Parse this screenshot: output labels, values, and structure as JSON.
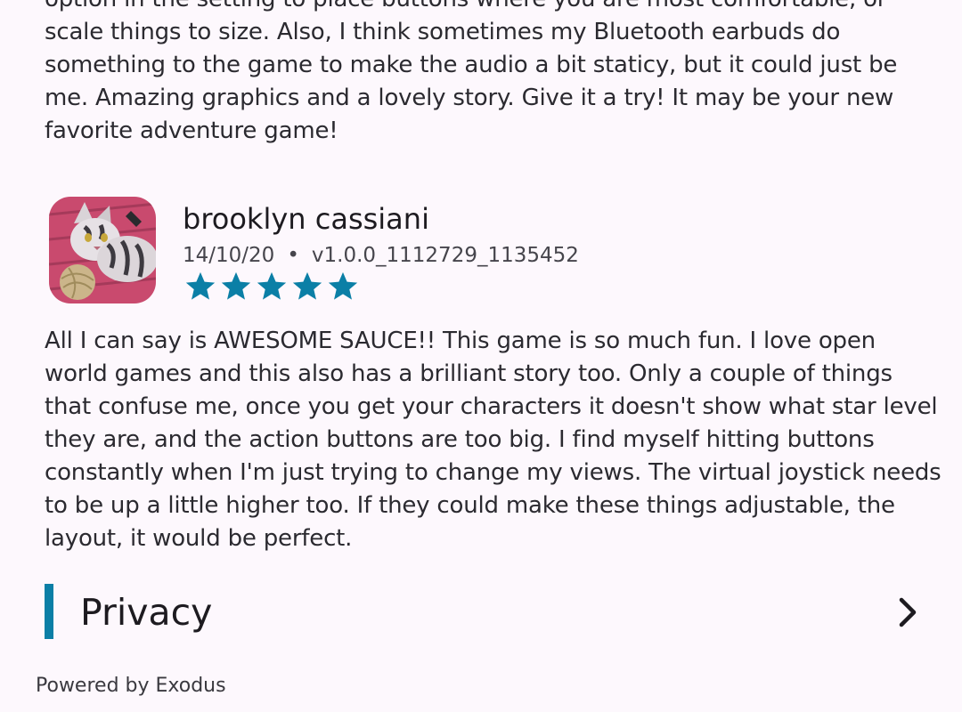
{
  "reviews": {
    "previous": {
      "text": "option in the setting to place buttons where you are most comfortable, or scale things to size. Also, I think sometimes my Bluetooth earbuds do something to the game to make the audio a bit staticy, but it could just be me. Amazing graphics and a lovely story. Give it a try! It may be your new favorite adventure game!"
    },
    "current": {
      "author": "brooklyn cassiani",
      "date": "14/10/20",
      "separator": "•",
      "version": "v1.0.0_1112729_1135452",
      "rating": 5,
      "rating_max": 5,
      "star_icon": "star-icon",
      "avatar_icon": "cat-avatar",
      "text": "All I can say is AWESOME SAUCE!! This game is so much fun. I love open world games and this also has a brilliant story too. Only a couple of things that confuse me, once you get your characters it doesn't show what star level they are, and the action buttons are too big. I find myself hitting buttons constantly when I'm just trying to change my views. The virtual joystick needs to be up a little higher too. If they could make these things adjustable, the layout, it would be perfect."
    }
  },
  "privacy": {
    "title": "Privacy",
    "chevron_icon": "chevron-right-icon"
  },
  "footer": {
    "powered_by": "Powered by Exodus"
  },
  "colors": {
    "background": "#fdf8fd",
    "accent": "#0b7fa6",
    "star": "#0b7fa6",
    "text": "#1d1b20"
  }
}
